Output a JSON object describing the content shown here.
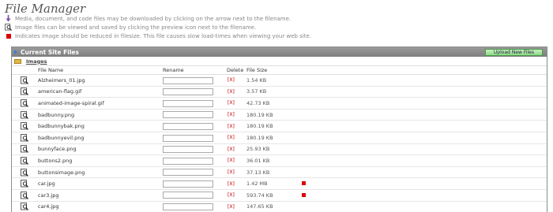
{
  "header": {
    "title": "File Manager",
    "notes": [
      "Media, document, and code files may be downloaded by clicking on the arrow next to the filename.",
      "Image files can be viewed and saved by clicking the preview icon next to the filename.",
      "Indicates image should be reduced in filesize. This file causes slow load-times when viewing your web site."
    ]
  },
  "panel": {
    "title": "Current Site Files",
    "upload_label": "Upload New Files",
    "folder_label": "Images",
    "columns": {
      "name": "File Name",
      "rename": "Rename",
      "delete": "Delete",
      "size": "File Size"
    },
    "delete_label": "[X]",
    "files": [
      {
        "name": "Alzheimers_01.jpg",
        "size": "1.54 KB",
        "flag": false
      },
      {
        "name": "american-flag.gif",
        "size": "3.57 KB",
        "flag": false
      },
      {
        "name": "animated-image-spiral.gif",
        "size": "42.73 KB",
        "flag": false
      },
      {
        "name": "badbunny.png",
        "size": "180.19 KB",
        "flag": false
      },
      {
        "name": "badbunnybak.png",
        "size": "180.19 KB",
        "flag": false
      },
      {
        "name": "badbunnyevil.png",
        "size": "180.19 KB",
        "flag": false
      },
      {
        "name": "bunnyface.png",
        "size": "25.93 KB",
        "flag": false
      },
      {
        "name": "buttons2.png",
        "size": "36.01 KB",
        "flag": false
      },
      {
        "name": "buttonsimage.png",
        "size": "37.13 KB",
        "flag": false
      },
      {
        "name": "car.jpg",
        "size": "1.42 MB",
        "flag": true
      },
      {
        "name": "car3.jpg",
        "size": "593.74 KB",
        "flag": true
      },
      {
        "name": "car4.jpg",
        "size": "147.65 KB",
        "flag": false
      }
    ]
  },
  "colors": {
    "flag": "#dd0000",
    "upload_button": "#8fd889",
    "header_bar": "#8a8a8a"
  }
}
